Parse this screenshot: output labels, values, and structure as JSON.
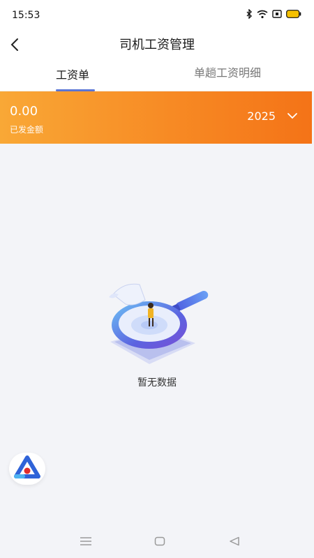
{
  "status_bar": {
    "time": "15:53",
    "icons": [
      "bluetooth-icon",
      "wifi-icon",
      "signal-box-icon",
      "battery-icon"
    ]
  },
  "nav": {
    "title": "司机工资管理",
    "back_icon": "chevron-left-icon"
  },
  "tabs": [
    {
      "label": "工资单",
      "active": true
    },
    {
      "label": "单趟工资明细",
      "active": false
    }
  ],
  "summary": {
    "amount": "0.00",
    "amount_label": "已发金额",
    "year": "2025",
    "year_icon": "chevron-down-icon"
  },
  "empty_state": {
    "text": "暂无数据",
    "illustration": "magnifier-empty-illustration"
  },
  "floating_button": {
    "icon": "app-logo-icon"
  },
  "system_nav": [
    "menu-icon",
    "home-icon",
    "back-icon"
  ],
  "colors": {
    "banner_start": "#f9a836",
    "banner_end": "#f47317",
    "tab_indicator": "#5b76d6",
    "background": "#f3f4f8"
  }
}
